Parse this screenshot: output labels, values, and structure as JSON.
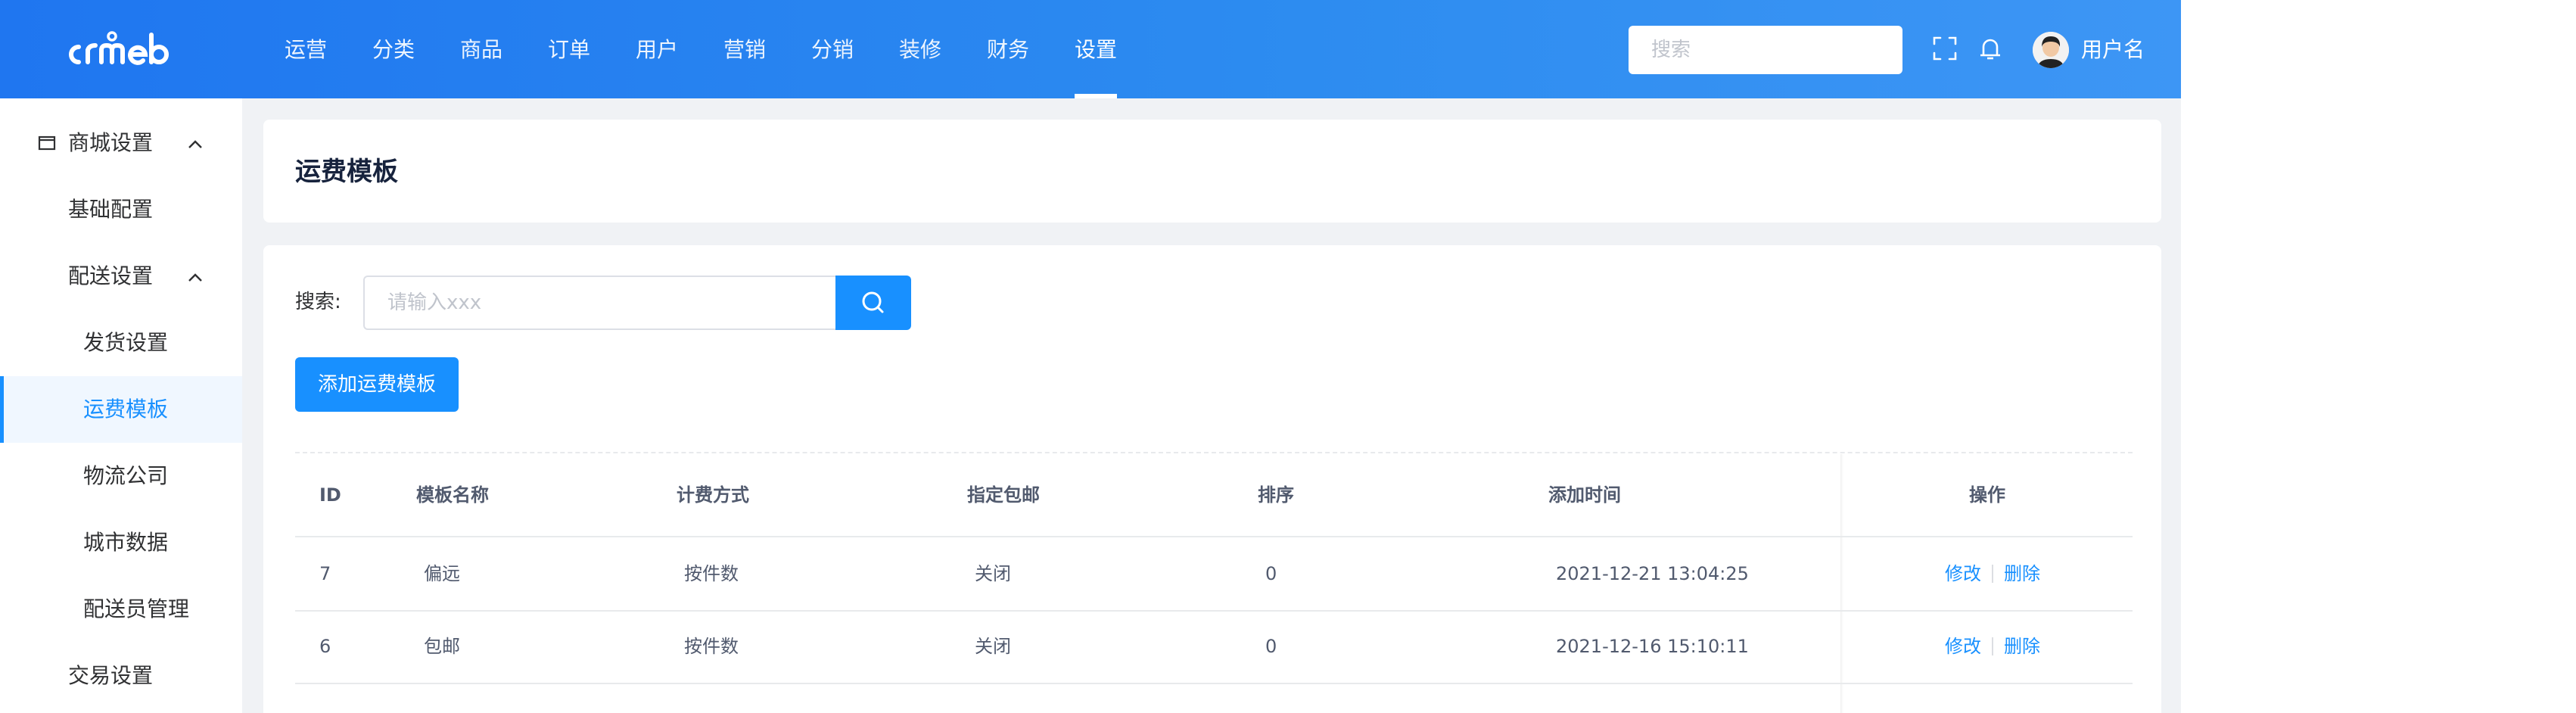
{
  "header": {
    "nav": [
      {
        "label": "运营"
      },
      {
        "label": "分类"
      },
      {
        "label": "商品"
      },
      {
        "label": "订单"
      },
      {
        "label": "用户"
      },
      {
        "label": "营销"
      },
      {
        "label": "分销"
      },
      {
        "label": "装修"
      },
      {
        "label": "财务"
      },
      {
        "label": "设置",
        "active": true
      }
    ],
    "search_placeholder": "搜索",
    "username": "用户名"
  },
  "sidebar": {
    "items": [
      {
        "label": "商城设置",
        "expanded": true
      },
      {
        "label": "基础配置"
      },
      {
        "label": "配送设置",
        "expanded": true
      },
      {
        "label": "发货设置"
      },
      {
        "label": "运费模板",
        "active": true
      },
      {
        "label": "物流公司"
      },
      {
        "label": "城市数据"
      },
      {
        "label": "配送员管理"
      },
      {
        "label": "交易设置"
      }
    ]
  },
  "page": {
    "title": "运费模板",
    "search_label": "搜索:",
    "search_placeholder": "请输入xxx",
    "add_button": "添加运费模板"
  },
  "table": {
    "columns": [
      "ID",
      "模板名称",
      "计费方式",
      "指定包邮",
      "排序",
      "添加时间",
      "操作"
    ],
    "rows": [
      {
        "id": "7",
        "name": "偏远",
        "billing": "按件数",
        "free_shipping": "关闭",
        "sort": "0",
        "added": "2021-12-21 13:04:25"
      },
      {
        "id": "6",
        "name": "包邮",
        "billing": "按件数",
        "free_shipping": "关闭",
        "sort": "0",
        "added": "2021-12-16 15:10:11"
      }
    ],
    "edit_label": "修改",
    "delete_label": "删除"
  },
  "colors": {
    "brand": "#1890ff",
    "header": "#2d8cf0"
  }
}
